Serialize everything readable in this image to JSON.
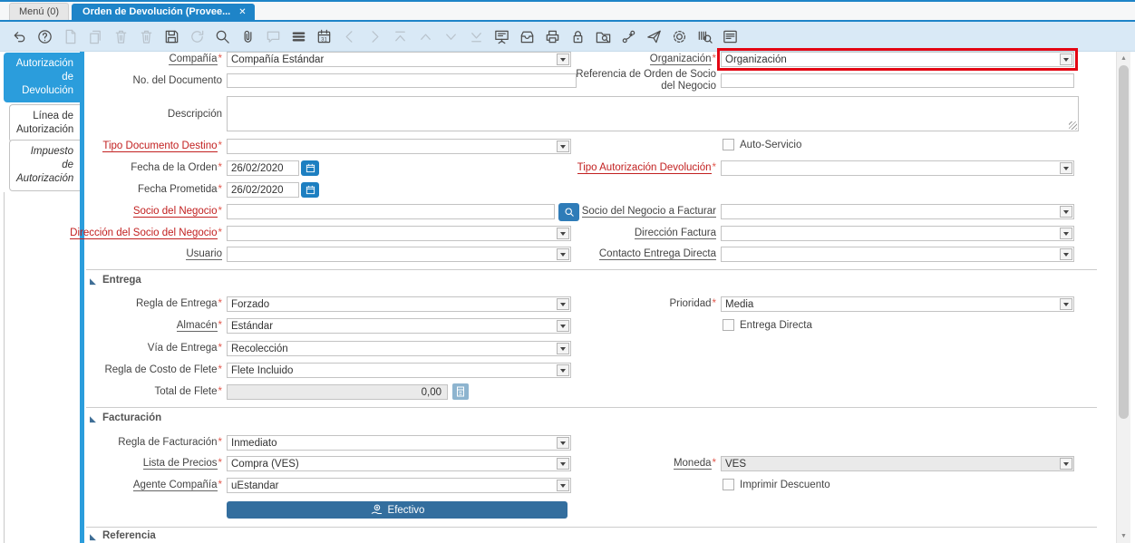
{
  "window_tabs": {
    "menu_tab": "Menú (0)",
    "active_tab": "Orden de Devolución (Provee...",
    "close_glyph": "✕"
  },
  "toolbar": {
    "icons": [
      {
        "name": "undo",
        "disabled": false
      },
      {
        "name": "help",
        "disabled": false
      },
      {
        "name": "new-record",
        "disabled": true
      },
      {
        "name": "copy-record",
        "disabled": true
      },
      {
        "name": "delete-record",
        "disabled": true
      },
      {
        "name": "delete-selection",
        "disabled": true
      },
      {
        "name": "save",
        "disabled": false
      },
      {
        "name": "requery",
        "disabled": true
      },
      {
        "name": "find",
        "disabled": false
      },
      {
        "name": "attachment",
        "disabled": false
      },
      {
        "name": "chat",
        "disabled": true
      },
      {
        "name": "toggle-grid",
        "disabled": false
      },
      {
        "name": "history",
        "disabled": false
      },
      {
        "name": "parent-record",
        "disabled": true
      },
      {
        "name": "detail-record",
        "disabled": true
      },
      {
        "name": "first-record",
        "disabled": true
      },
      {
        "name": "previous-record",
        "disabled": true
      },
      {
        "name": "next-record",
        "disabled": true
      },
      {
        "name": "last-record",
        "disabled": true
      },
      {
        "name": "report",
        "disabled": false
      },
      {
        "name": "archive",
        "disabled": false
      },
      {
        "name": "print",
        "disabled": false
      },
      {
        "name": "lock",
        "disabled": false
      },
      {
        "name": "zoom-across",
        "disabled": false
      },
      {
        "name": "workflow",
        "disabled": false
      },
      {
        "name": "send-mail",
        "disabled": false
      },
      {
        "name": "preferences",
        "disabled": false
      },
      {
        "name": "product-info",
        "disabled": false
      },
      {
        "name": "report-window",
        "disabled": false
      }
    ]
  },
  "sidebar": {
    "tabs": [
      {
        "label": "Autorización\nde\nDevolución",
        "active": true
      },
      {
        "label": "Línea de\nAutorización",
        "active": false
      },
      {
        "label": "Impuesto\nde\nAutorización",
        "active": false
      }
    ]
  },
  "form": {
    "required_marker": "*",
    "sections": {
      "entrega": "Entrega",
      "facturacion": "Facturación",
      "referencia": "Referencia"
    },
    "fields": {
      "compania": {
        "label": "Compañía",
        "value": "Compañía Estándar"
      },
      "organizacion": {
        "label": "Organización",
        "value": "Organización"
      },
      "no_documento": {
        "label": "No. del Documento",
        "value": ""
      },
      "referencia_orden": {
        "label": "Referencia de Orden de Socio del Negocio",
        "value": ""
      },
      "descripcion": {
        "label": "Descripción",
        "value": ""
      },
      "tipo_documento_destino": {
        "label": "Tipo Documento Destino",
        "value": ""
      },
      "auto_servicio": {
        "label": "Auto-Servicio",
        "checked": false
      },
      "fecha_orden": {
        "label": "Fecha de la Orden",
        "value": "26/02/2020"
      },
      "tipo_autorizacion_devolucion": {
        "label": "Tipo Autorización Devolución",
        "value": ""
      },
      "fecha_prometida": {
        "label": "Fecha Prometida",
        "value": "26/02/2020"
      },
      "socio_negocio": {
        "label": "Socio del Negocio",
        "value": ""
      },
      "socio_negocio_facturar": {
        "label": "Socio del Negocio a Facturar",
        "value": ""
      },
      "direccion_socio": {
        "label": "Dirección del Socio del Negocio",
        "value": ""
      },
      "direccion_factura": {
        "label": "Dirección Factura",
        "value": ""
      },
      "usuario": {
        "label": "Usuario",
        "value": ""
      },
      "contacto_entrega": {
        "label": "Contacto Entrega Directa",
        "value": ""
      },
      "regla_entrega": {
        "label": "Regla de Entrega",
        "value": "Forzado"
      },
      "prioridad": {
        "label": "Prioridad",
        "value": "Media"
      },
      "almacen": {
        "label": "Almacén",
        "value": "Estándar"
      },
      "entrega_directa": {
        "label": "Entrega Directa",
        "checked": false
      },
      "via_entrega": {
        "label": "Vía de Entrega",
        "value": "Recolección"
      },
      "regla_costo_flete": {
        "label": "Regla de Costo de Flete",
        "value": "Flete Incluido"
      },
      "total_flete": {
        "label": "Total de Flete",
        "value": "0,00"
      },
      "regla_facturacion": {
        "label": "Regla de Facturación",
        "value": "Inmediato"
      },
      "lista_precios": {
        "label": "Lista de Precios",
        "value": "Compra (VES)"
      },
      "moneda": {
        "label": "Moneda",
        "value": "VES"
      },
      "imprimir_descuento": {
        "label": "Imprimir Descuento",
        "checked": false
      },
      "agente_compania": {
        "label": "Agente Compañía",
        "value": "uEstandar"
      }
    },
    "buttons": {
      "efectivo": "Efectivo"
    }
  },
  "colors": {
    "accent_blue": "#1e84c8",
    "sidebar_blue": "#2b9ddc",
    "toolbar_bg": "#d9e9f6",
    "highlight_red": "#e30613",
    "required_red": "#c22020",
    "button_blue": "#336e9e"
  }
}
